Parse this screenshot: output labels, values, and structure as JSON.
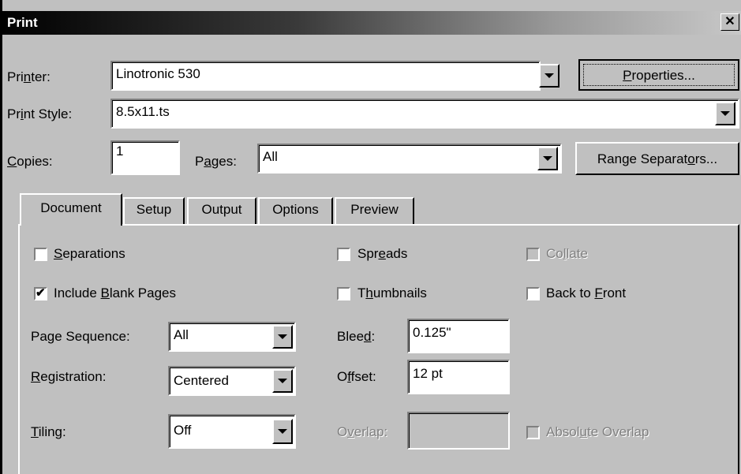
{
  "window": {
    "title": "Print",
    "close_glyph": "✕"
  },
  "printer": {
    "label_pre": "Pri",
    "label_u": "n",
    "label_post": "ter:",
    "value": "Linotronic 530"
  },
  "properties_button": {
    "label_u": "P",
    "label_post": "roperties..."
  },
  "print_style": {
    "label_pre": "Pr",
    "label_u": "i",
    "label_post": "nt Style:",
    "value": "8.5x11.ts"
  },
  "copies": {
    "label_u": "C",
    "label_post": "opies:",
    "value": "1"
  },
  "pages": {
    "label_pre": "P",
    "label_u": "a",
    "label_post": "ges:",
    "value": "All"
  },
  "range_button": {
    "label_pre": "Range Separat",
    "label_u": "o",
    "label_post": "rs..."
  },
  "tabs": [
    "Document",
    "Setup",
    "Output",
    "Options",
    "Preview"
  ],
  "document": {
    "separations": {
      "label_u": "S",
      "label_post": "eparations",
      "checked": false
    },
    "spreads": {
      "label_pre": "Spr",
      "label_u": "e",
      "label_post": "ads",
      "checked": false
    },
    "collate": {
      "label_pre": "Co",
      "label_u": "l",
      "label_post": "late",
      "checked": false,
      "disabled": true
    },
    "include_blank": {
      "label_pre": "Include ",
      "label_u": "B",
      "label_post": "lank Pages",
      "checked": true,
      "check_glyph": "✔"
    },
    "thumbnails": {
      "label_pre": "T",
      "label_u": "h",
      "label_post": "umbnails",
      "checked": false
    },
    "back_to_front": {
      "label_pre": "Back to ",
      "label_u": "F",
      "label_post": "ront",
      "checked": false
    },
    "page_sequence": {
      "label": "Page Sequence:",
      "value": "All"
    },
    "bleed": {
      "label_pre": "Blee",
      "label_u": "d",
      "label_post": ":",
      "value": "0.125\""
    },
    "registration": {
      "label_u": "R",
      "label_post": "egistration:",
      "value": "Centered"
    },
    "offset": {
      "label_pre": "O",
      "label_u": "f",
      "label_post": "fset:",
      "value": "12 pt"
    },
    "tiling": {
      "label_u": "T",
      "label_post": "iling:",
      "value": "Off"
    },
    "overlap": {
      "label_pre": "O",
      "label_u": "v",
      "label_post": "erlap:",
      "value": "",
      "disabled": true
    },
    "absolute_overlap": {
      "label_pre": "Absol",
      "label_u": "u",
      "label_post": "te Overlap",
      "checked": false,
      "disabled": true
    }
  }
}
